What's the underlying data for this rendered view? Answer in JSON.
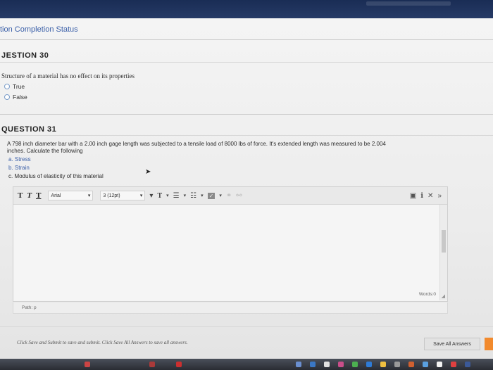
{
  "breadcrumb": "tion Completion Status",
  "q30": {
    "heading": "JESTION 30",
    "text": "Structure of a material has no effect on its properties",
    "options": [
      "True",
      "False"
    ]
  },
  "q31": {
    "heading": "QUESTION 31",
    "line1": "A 798 inch diameter bar with a 2.00 inch gage length was subjected to a tensile load of 8000 lbs of force. It's extended length was measured to be 2.004",
    "line2": "inches. Calculate the following",
    "parts": [
      "a. Stress",
      "b. Strain",
      "c. Modulus of elasticity of this material"
    ]
  },
  "editor": {
    "bold": "T",
    "italic": "T",
    "underline": "T",
    "font_family": "Arial",
    "font_size": "3 (12pt)",
    "path_label": "Path: p",
    "words_label": "Words:0"
  },
  "footer": {
    "note": "Click Save and Submit to save and submit. Click Save All Answers to save all answers.",
    "save_all_label": "Save All Answers"
  },
  "colors": {
    "accent_orange": "#f28a2d",
    "link_blue": "#3a5fa8"
  }
}
